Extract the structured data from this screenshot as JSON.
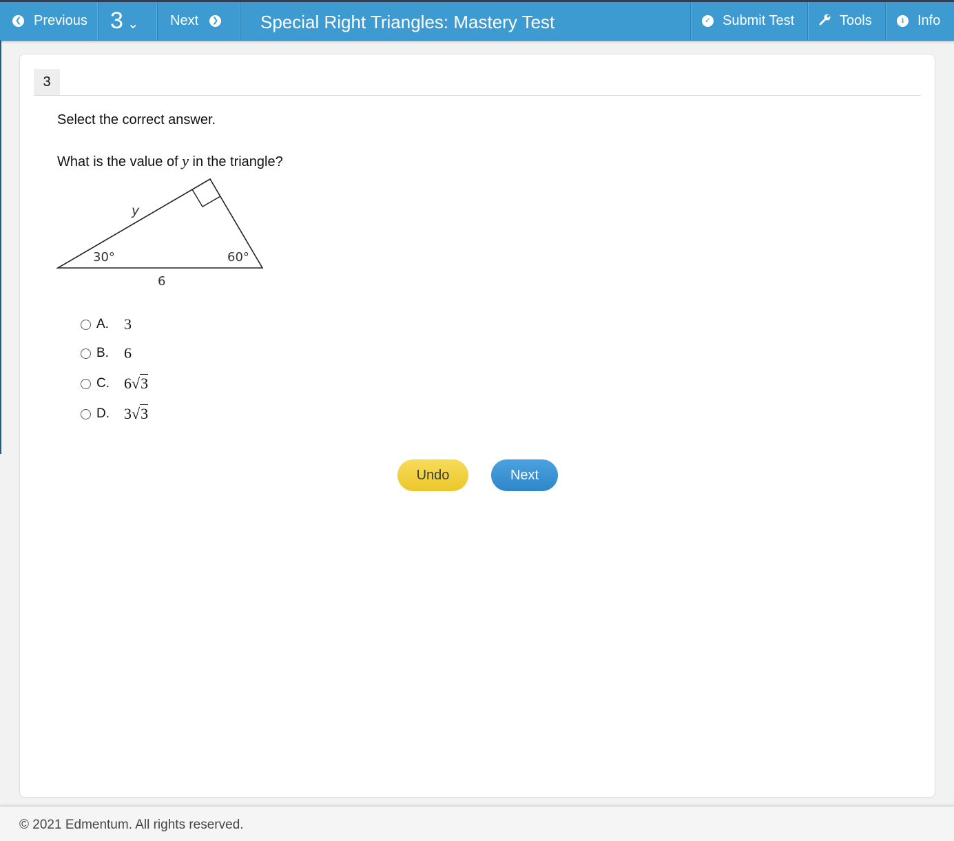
{
  "topbar": {
    "previous_label": "Previous",
    "question_number": "3",
    "next_label": "Next",
    "title": "Special Right Triangles: Mastery Test",
    "submit_label": "Submit Test",
    "tools_label": "Tools",
    "info_label": "Info"
  },
  "question": {
    "tab_number": "3",
    "instruction": "Select the correct answer.",
    "prompt_before": "What is the value of ",
    "prompt_var": "y",
    "prompt_after": " in the triangle?",
    "figure": {
      "side_label_hyp": "y",
      "side_label_base": "6",
      "angle_left": "30°",
      "angle_right": "60°"
    },
    "options": [
      {
        "letter": "A.",
        "value": "3"
      },
      {
        "letter": "B.",
        "value": "6"
      },
      {
        "letter": "C.",
        "coef": "6",
        "radicand": "3"
      },
      {
        "letter": "D.",
        "coef": "3",
        "radicand": "3"
      }
    ]
  },
  "buttons": {
    "undo_label": "Undo",
    "next_label": "Next"
  },
  "footer": {
    "copyright": "© 2021 Edmentum. All rights reserved."
  },
  "icons": {
    "previous": "arrow-left-circle-icon",
    "question_dropdown": "chevron-down-icon",
    "next": "arrow-right-circle-icon",
    "submit": "check-circle-icon",
    "tools": "wrench-icon",
    "info": "info-circle-icon"
  },
  "colors": {
    "topbar": "#3d9bd1",
    "undo_button": "#f0cd3a",
    "next_button": "#3a93d4"
  }
}
